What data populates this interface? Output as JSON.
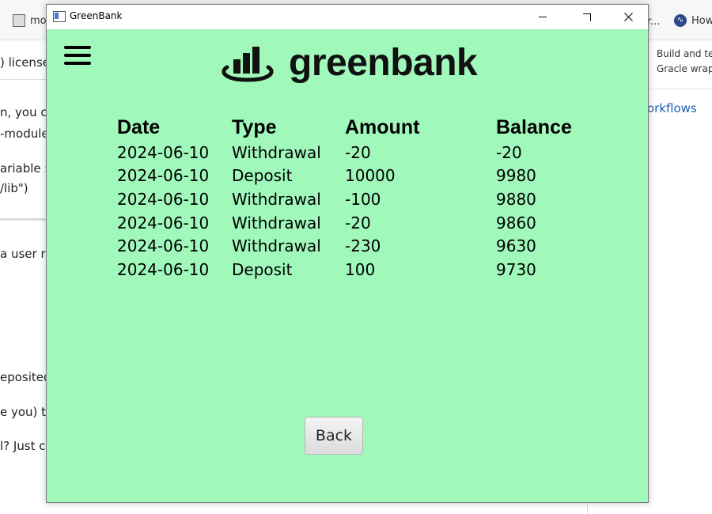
{
  "background": {
    "tab_left_text": "mo",
    "tab_right_text": "r...",
    "tab_right2_text": "How",
    "left_fragments": ") license",
    "left_line2": "n, you c",
    "left_line3": "-module",
    "left_line4": "ariable $",
    "left_line5": "/lib\")",
    "left_line6": "a user r",
    "left_line7": "eposited",
    "left_line8": "e you) to",
    "left_line9": "l? Just cl",
    "right_line1": "Build and te",
    "right_line2": "Gracle wrap",
    "right_link": "orkflows"
  },
  "window": {
    "title": "GreenBank",
    "controls": {
      "minimize": "minimize",
      "maximize": "maximize",
      "close": "close"
    }
  },
  "app": {
    "brand": "greenbank",
    "colors": {
      "background": "#a0f8bb",
      "text": "#000000"
    },
    "table": {
      "headers": [
        "Date",
        "Type",
        "Amount",
        "Balance"
      ],
      "rows": [
        [
          "2024-06-10",
          "Withdrawal",
          "-20",
          "-20"
        ],
        [
          "2024-06-10",
          "Deposit",
          "10000",
          "9980"
        ],
        [
          "2024-06-10",
          "Withdrawal",
          "-100",
          "9880"
        ],
        [
          "2024-06-10",
          "Withdrawal",
          "-20",
          "9860"
        ],
        [
          "2024-06-10",
          "Withdrawal",
          "-230",
          "9630"
        ],
        [
          "2024-06-10",
          "Deposit",
          "100",
          "9730"
        ]
      ]
    },
    "back_label": "Back",
    "icons": {
      "menu": "hamburger-menu-icon",
      "logo": "bank-bars-icon"
    }
  }
}
